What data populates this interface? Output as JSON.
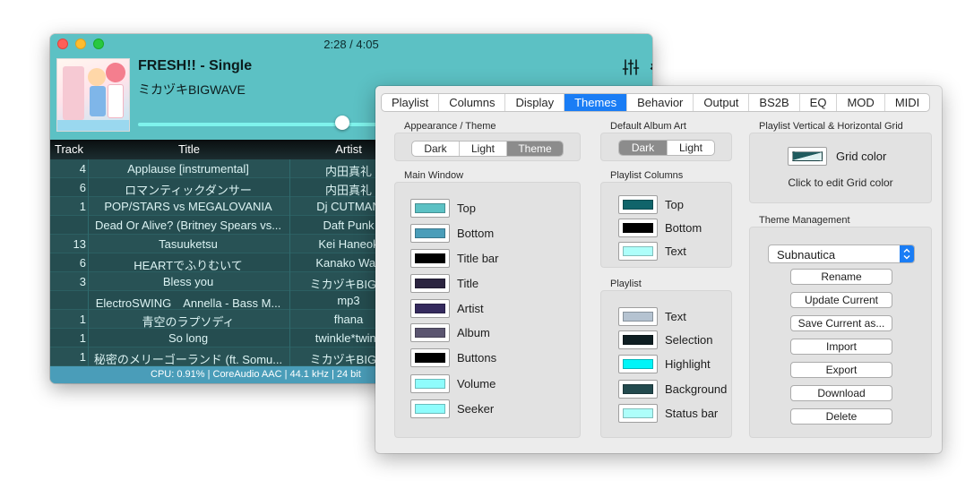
{
  "player": {
    "time": "2:28 / 4:05",
    "song_title": "FRESH!! - Single",
    "song_artist": "ミカヅキBIGWAVE",
    "icons": {
      "equalizer": "sliders-icon",
      "settings": "gear-icon"
    },
    "progress_fraction": 0.6,
    "columns": {
      "track": "Track",
      "title": "Title",
      "artist": "Artist"
    },
    "rows": [
      {
        "track": "4",
        "title": "Applause [instrumental]",
        "artist": "内田真礼"
      },
      {
        "track": "6",
        "title": "ロマンティックダンサー",
        "artist": "内田真礼"
      },
      {
        "track": "1",
        "title": "POP/STARS vs MEGALOVANIA",
        "artist": "Dj CUTMAN"
      },
      {
        "track": "",
        "title": "Dead Or Alive? (Britney Spears vs...",
        "artist": "Daft Punk"
      },
      {
        "track": "13",
        "title": "Tasuuketsu",
        "artist": "Kei Haneok"
      },
      {
        "track": "6",
        "title": "HEARTでふりむいて",
        "artist": "Kanako Wac"
      },
      {
        "track": "3",
        "title": "Bless you",
        "artist": "ミカヅキBIGW"
      },
      {
        "track": "",
        "title": "ElectroSWING　Annella - Bass M...",
        "artist": "mp3"
      },
      {
        "track": "1",
        "title": "青空のラプソディ",
        "artist": "fhana"
      },
      {
        "track": "1",
        "title": "So long",
        "artist": "twinkle*twink"
      },
      {
        "track": "1",
        "title": "秘密のメリーゴーランド (ft. Somu...",
        "artist": "ミカヅキBIGW"
      }
    ],
    "status": "CPU: 0.91% | CoreAudio AAC | 44.1 kHz | 24 bit"
  },
  "prefs": {
    "tabs": [
      {
        "label": "Playlist",
        "active": false
      },
      {
        "label": "Columns",
        "active": false
      },
      {
        "label": "Display",
        "active": false
      },
      {
        "label": "Themes",
        "active": true
      },
      {
        "label": "Behavior",
        "active": false
      },
      {
        "label": "Output",
        "active": false
      },
      {
        "label": "BS2B",
        "active": false
      },
      {
        "label": "EQ",
        "active": false
      },
      {
        "label": "MOD",
        "active": false
      },
      {
        "label": "MIDI",
        "active": false
      }
    ],
    "appearance": {
      "label": "Appearance / Theme",
      "options": [
        "Dark",
        "Light",
        "Theme"
      ],
      "selected": "Theme"
    },
    "album_art": {
      "label": "Default Album Art",
      "options": [
        "Dark",
        "Light"
      ],
      "selected": "Dark"
    },
    "grid": {
      "label": "Playlist Vertical & Horizontal Grid",
      "color_label": "Grid color",
      "hint": "Click to edit Grid color"
    },
    "main_window": {
      "label": "Main Window",
      "colors": [
        {
          "name": "Top",
          "color": "#5cc1c4"
        },
        {
          "name": "Bottom",
          "color": "#4a9db9"
        },
        {
          "name": "Title bar",
          "color": "#000000"
        },
        {
          "name": "Title",
          "color": "#2b2440"
        },
        {
          "name": "Artist",
          "color": "#352a5e"
        },
        {
          "name": "Album",
          "color": "#5b5570"
        },
        {
          "name": "Buttons",
          "color": "#000000"
        },
        {
          "name": "Volume",
          "color": "#8ffcfc"
        },
        {
          "name": "Seeker",
          "color": "#8ffcfc"
        }
      ]
    },
    "playlist_columns": {
      "label": "Playlist Columns",
      "colors": [
        {
          "name": "Top",
          "color": "#10646a"
        },
        {
          "name": "Bottom",
          "color": "#000000"
        },
        {
          "name": "Text",
          "color": "#aefefa"
        }
      ]
    },
    "playlist": {
      "label": "Playlist",
      "colors": [
        {
          "name": "Text",
          "color": "#b5c3d1"
        },
        {
          "name": "Selection",
          "color": "#0e1e22"
        },
        {
          "name": "Highlight",
          "color": "#00f5f8"
        },
        {
          "name": "Background",
          "color": "#234a4e"
        },
        {
          "name": "Status bar",
          "color": "#aefefa"
        }
      ]
    },
    "theme_management": {
      "label": "Theme Management",
      "selected_theme": "Subnautica",
      "buttons": [
        "Rename",
        "Update Current",
        "Save Current as...",
        "Import",
        "Export",
        "Download",
        "Delete"
      ]
    }
  }
}
